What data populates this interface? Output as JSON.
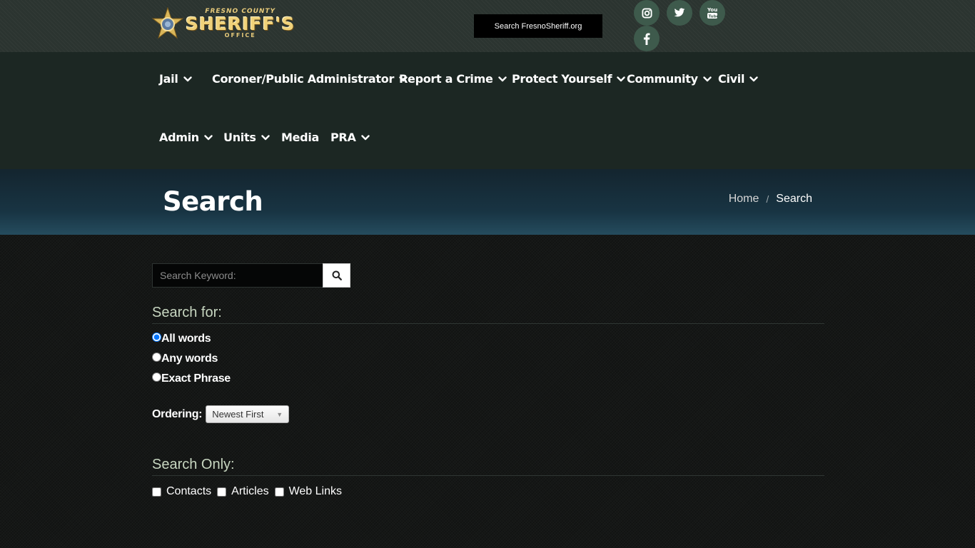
{
  "header": {
    "logo": {
      "top_text": "FRESNO COUNTY",
      "main_text": "SHERIFF'S",
      "sub_text": "OFFICE"
    },
    "search_button_label": "Search FresnoSheriff.org",
    "social_icons": [
      "instagram-icon",
      "twitter-icon",
      "youtube-icon",
      "facebook-icon"
    ]
  },
  "nav": {
    "items": [
      {
        "label": "Jail",
        "has_dropdown": true
      },
      {
        "label": "Coroner/Public Administrator",
        "has_dropdown": true
      },
      {
        "label": "Report a Crime",
        "has_dropdown": true
      },
      {
        "label": "Protect Yourself",
        "has_dropdown": true
      },
      {
        "label": "Community",
        "has_dropdown": true
      },
      {
        "label": "Civil",
        "has_dropdown": true
      },
      {
        "label": "Admin",
        "has_dropdown": true
      },
      {
        "label": "Units",
        "has_dropdown": true
      },
      {
        "label": "Media",
        "has_dropdown": false
      },
      {
        "label": "PRA",
        "has_dropdown": true
      }
    ]
  },
  "banner": {
    "title": "Search",
    "breadcrumb": {
      "home": "Home",
      "separator": "/",
      "current": "Search"
    }
  },
  "search": {
    "keyword_placeholder": "Search Keyword:",
    "keyword_value": "",
    "search_for_heading": "Search for:",
    "options": [
      {
        "label": "All words",
        "checked": true
      },
      {
        "label": "Any words",
        "checked": false
      },
      {
        "label": "Exact Phrase",
        "checked": false
      }
    ],
    "ordering_label": "Ordering:",
    "ordering_value": "Newest First",
    "search_only_heading": "Search Only:",
    "areas": [
      {
        "label": "Contacts",
        "checked": false
      },
      {
        "label": "Articles",
        "checked": false
      },
      {
        "label": "Web Links",
        "checked": false
      }
    ]
  },
  "colors": {
    "topbar": "#2b3430",
    "navbar": "#1c2723",
    "social_circle": "#3e5a4c",
    "section_heading": "#c7d6c0",
    "logo_gold": "#f0d27a"
  }
}
